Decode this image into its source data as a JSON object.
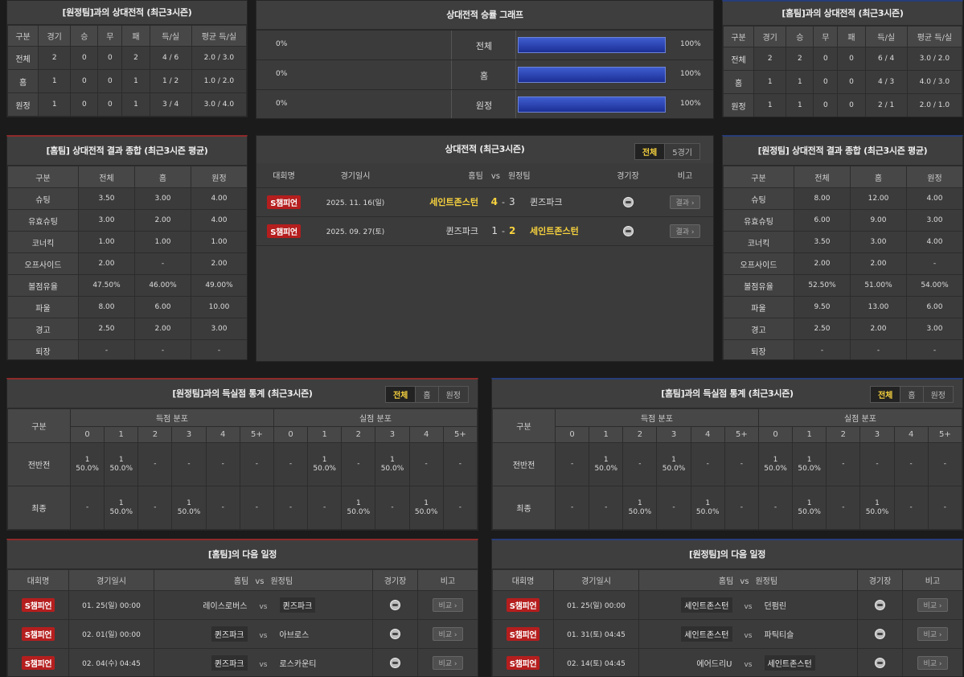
{
  "h2h_left": {
    "title": "[원정팀]과의 상대전적 (최근3시즌)",
    "headers": [
      "구분",
      "경기",
      "승",
      "무",
      "패",
      "득/실",
      "평균 득/실"
    ],
    "rows": [
      [
        "전체",
        "2",
        "0",
        "0",
        "2",
        "4 / 6",
        "2.0 / 3.0"
      ],
      [
        "홈",
        "1",
        "0",
        "0",
        "1",
        "1 / 2",
        "1.0 / 2.0"
      ],
      [
        "원정",
        "1",
        "0",
        "0",
        "1",
        "3 / 4",
        "3.0 / 4.0"
      ]
    ]
  },
  "h2h_right": {
    "title": "[홈팀]과의 상대전적 (최근3시즌)",
    "headers": [
      "구분",
      "경기",
      "승",
      "무",
      "패",
      "득/실",
      "평균 득/실"
    ],
    "rows": [
      [
        "전체",
        "2",
        "2",
        "0",
        "0",
        "6 / 4",
        "3.0 / 2.0"
      ],
      [
        "홈",
        "1",
        "1",
        "0",
        "0",
        "4 / 3",
        "4.0 / 3.0"
      ],
      [
        "원정",
        "1",
        "1",
        "0",
        "0",
        "2 / 1",
        "2.0 / 1.0"
      ]
    ]
  },
  "winrate": {
    "title": "상대전적 승률 그래프",
    "rows": [
      {
        "left": "0%",
        "label": "전체",
        "right": "100%",
        "fill": 1.0
      },
      {
        "left": "0%",
        "label": "홈",
        "right": "100%",
        "fill": 1.0
      },
      {
        "left": "0%",
        "label": "원정",
        "right": "100%",
        "fill": 1.0
      }
    ]
  },
  "summary_left": {
    "title": "[홈팀] 상대전적 결과 종합 (최근3시즌 평균)",
    "headers": [
      "구분",
      "전체",
      "홈",
      "원정"
    ],
    "rows": [
      [
        "슈팅",
        "3.50",
        "3.00",
        "4.00"
      ],
      [
        "유효슈팅",
        "3.00",
        "2.00",
        "4.00"
      ],
      [
        "코너킥",
        "1.00",
        "1.00",
        "1.00"
      ],
      [
        "오프사이드",
        "2.00",
        "-",
        "2.00"
      ],
      [
        "볼점유율",
        "47.50%",
        "46.00%",
        "49.00%"
      ],
      [
        "파울",
        "8.00",
        "6.00",
        "10.00"
      ],
      [
        "경고",
        "2.50",
        "2.00",
        "3.00"
      ],
      [
        "퇴장",
        "-",
        "-",
        "-"
      ]
    ]
  },
  "summary_right": {
    "title": "[원정팀] 상대전적 결과 종합 (최근3시즌 평균)",
    "headers": [
      "구분",
      "전체",
      "홈",
      "원정"
    ],
    "rows": [
      [
        "슈팅",
        "8.00",
        "12.00",
        "4.00"
      ],
      [
        "유효슈팅",
        "6.00",
        "9.00",
        "3.00"
      ],
      [
        "코너킥",
        "3.50",
        "3.00",
        "4.00"
      ],
      [
        "오프사이드",
        "2.00",
        "2.00",
        "-"
      ],
      [
        "볼점유율",
        "52.50%",
        "51.00%",
        "54.00%"
      ],
      [
        "파울",
        "9.50",
        "13.00",
        "6.00"
      ],
      [
        "경고",
        "2.50",
        "2.00",
        "3.00"
      ],
      [
        "퇴장",
        "-",
        "-",
        "-"
      ]
    ]
  },
  "matches": {
    "title": "상대전적 (최근3시즌)",
    "tabs": [
      "전체",
      "5경기"
    ],
    "headers": {
      "league": "대회명",
      "date": "경기일시",
      "home": "홈팀",
      "vs": "vs",
      "away": "원정팀",
      "venue": "경기장",
      "note": "비고"
    },
    "rows": [
      {
        "league": "S챔피언",
        "date": "2025. 11. 16(일)",
        "home": "세인트존스턴",
        "hs": "4",
        "sep": "-",
        "as": "3",
        "away": "퀸즈파크",
        "btn": "결과 ›"
      },
      {
        "league": "S챔피언",
        "date": "2025. 09. 27(토)",
        "home": "퀸즈파크",
        "hs": "1",
        "sep": "-",
        "as": "2",
        "away": "세인트존스턴",
        "btn": "결과 ›"
      }
    ]
  },
  "goals_left": {
    "title": "[원정팀]과의 득실점 통계 (최근3시즌)",
    "tabs": [
      "전체",
      "홈",
      "원정"
    ],
    "head": {
      "cat": "구분",
      "scored": "득점 분포",
      "conceded": "실점 분포"
    },
    "cols": [
      "0",
      "1",
      "2",
      "3",
      "4",
      "5+"
    ],
    "rows": [
      {
        "label": "전반전",
        "cells": [
          [
            "1",
            "50.0%"
          ],
          [
            "1",
            "50.0%"
          ],
          [
            "-"
          ],
          [
            "-"
          ],
          [
            "-"
          ],
          [
            "-"
          ],
          [
            "-"
          ],
          [
            "1",
            "50.0%"
          ],
          [
            "-"
          ],
          [
            "1",
            "50.0%"
          ],
          [
            "-"
          ],
          [
            "-"
          ]
        ]
      },
      {
        "label": "최종",
        "cells": [
          [
            "-"
          ],
          [
            "1",
            "50.0%"
          ],
          [
            "-"
          ],
          [
            "1",
            "50.0%"
          ],
          [
            "-"
          ],
          [
            "-"
          ],
          [
            "-"
          ],
          [
            "-"
          ],
          [
            "1",
            "50.0%"
          ],
          [
            "-"
          ],
          [
            "1",
            "50.0%"
          ],
          [
            "-"
          ]
        ]
      }
    ]
  },
  "goals_right": {
    "title": "[홈팀]과의 득실점 통계 (최근3시즌)",
    "tabs": [
      "전체",
      "홈",
      "원정"
    ],
    "head": {
      "cat": "구분",
      "scored": "득점 분포",
      "conceded": "실점 분포"
    },
    "cols": [
      "0",
      "1",
      "2",
      "3",
      "4",
      "5+"
    ],
    "rows": [
      {
        "label": "전반전",
        "cells": [
          [
            "-"
          ],
          [
            "1",
            "50.0%"
          ],
          [
            "-"
          ],
          [
            "1",
            "50.0%"
          ],
          [
            "-"
          ],
          [
            "-"
          ],
          [
            "1",
            "50.0%"
          ],
          [
            "1",
            "50.0%"
          ],
          [
            "-"
          ],
          [
            "-"
          ],
          [
            "-"
          ],
          [
            "-"
          ]
        ]
      },
      {
        "label": "최종",
        "cells": [
          [
            "-"
          ],
          [
            "-"
          ],
          [
            "1",
            "50.0%"
          ],
          [
            "-"
          ],
          [
            "1",
            "50.0%"
          ],
          [
            "-"
          ],
          [
            "-"
          ],
          [
            "1",
            "50.0%"
          ],
          [
            "-"
          ],
          [
            "1",
            "50.0%"
          ],
          [
            "-"
          ],
          [
            "-"
          ]
        ]
      }
    ]
  },
  "next_left": {
    "title": "[홈팀]의 다음 일정",
    "headers": {
      "league": "대회명",
      "date": "경기일시",
      "home": "홈팀",
      "vs": "vs",
      "away": "원정팀",
      "venue": "경기장",
      "note": "비고"
    },
    "rows": [
      {
        "league": "S챔피언",
        "date": "01. 25(일) 00:00",
        "home": "레이스로버스",
        "vs": "vs",
        "away": "퀸즈파크",
        "hl": "away",
        "btn": "비교 ›"
      },
      {
        "league": "S챔피언",
        "date": "02. 01(일) 00:00",
        "home": "퀸즈파크",
        "vs": "vs",
        "away": "아브로스",
        "hl": "home",
        "btn": "비교 ›"
      },
      {
        "league": "S챔피언",
        "date": "02. 04(수) 04:45",
        "home": "퀸즈파크",
        "vs": "vs",
        "away": "로스카운티",
        "hl": "home",
        "btn": "비교 ›"
      }
    ]
  },
  "next_right": {
    "title": "[원정팀]의 다음 일정",
    "headers": {
      "league": "대회명",
      "date": "경기일시",
      "home": "홈팀",
      "vs": "vs",
      "away": "원정팀",
      "venue": "경기장",
      "note": "비고"
    },
    "rows": [
      {
        "league": "S챔피언",
        "date": "01. 25(일) 00:00",
        "home": "세인트존스턴",
        "vs": "vs",
        "away": "던펌린",
        "hl": "home",
        "btn": "비교 ›"
      },
      {
        "league": "S챔피언",
        "date": "01. 31(토) 04:45",
        "home": "세인트존스턴",
        "vs": "vs",
        "away": "파틱티슬",
        "hl": "home",
        "btn": "비교 ›"
      },
      {
        "league": "S챔피언",
        "date": "02. 14(토) 04:45",
        "home": "에어드리U",
        "vs": "vs",
        "away": "세인트존스턴",
        "hl": "away",
        "btn": "비교 ›"
      }
    ]
  }
}
